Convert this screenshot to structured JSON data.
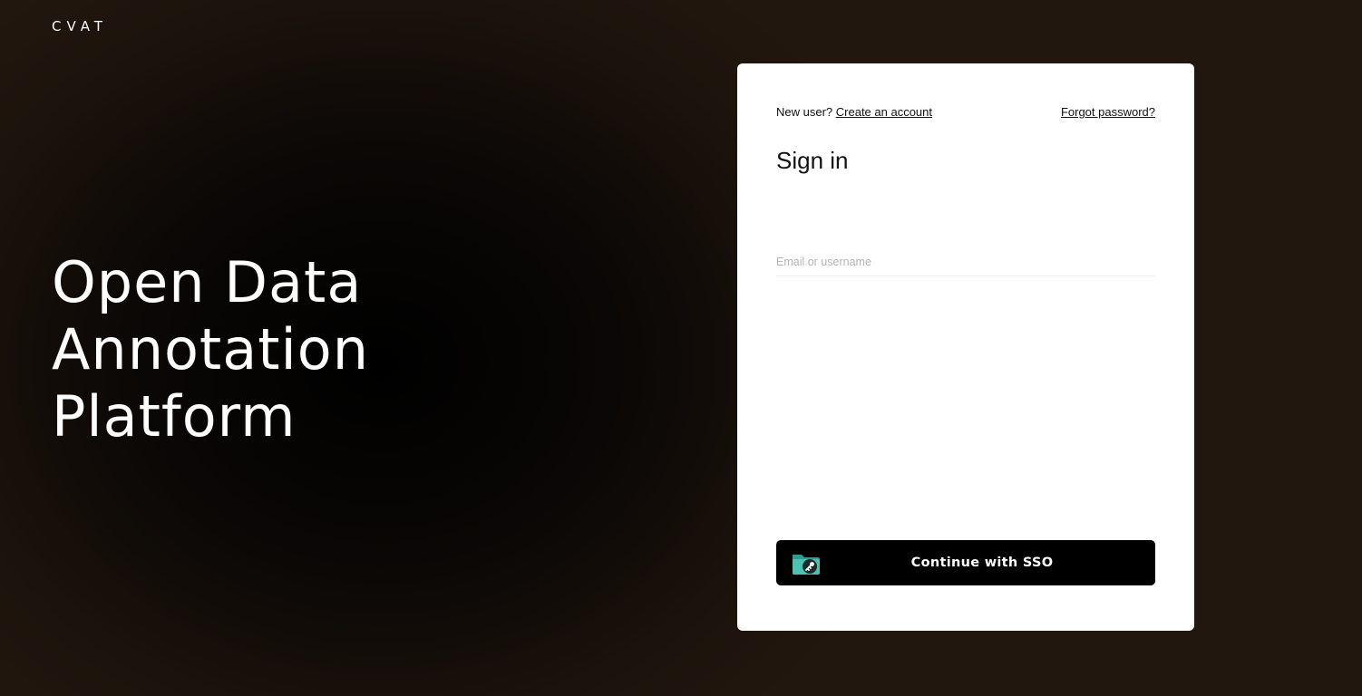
{
  "brand": {
    "logo_text": "CVAT"
  },
  "hero": {
    "line1": "Open Data",
    "line2": "Annotation",
    "line3": "Platform"
  },
  "signin_card": {
    "new_user_prefix": "New user?",
    "create_account_link": "Create an account",
    "forgot_password_link": "Forgot password?",
    "title": "Sign in",
    "email_field": {
      "placeholder": "Email or username",
      "value": ""
    },
    "sso_button_label": "Continue with SSO"
  },
  "colors": {
    "background": "#1e150d",
    "card": "#ffffff",
    "button": "#000000",
    "sso_icon_accent": "#3fb8a8"
  }
}
